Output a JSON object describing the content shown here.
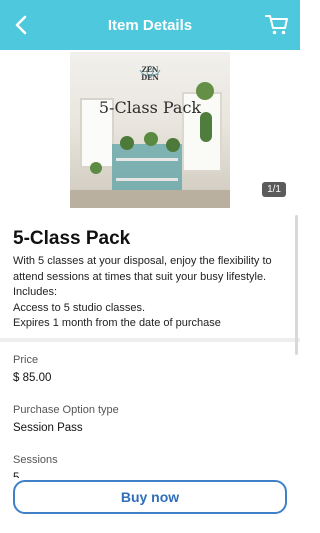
{
  "header": {
    "title": "Item Details",
    "back_icon": "chevron-left-icon",
    "cart_icon": "cart-icon"
  },
  "image": {
    "logo_line1": "ZEN",
    "logo_line2": "DEN",
    "caption": "5-Class Pack",
    "counter": "1/1"
  },
  "item": {
    "title": "5-Class Pack",
    "description_lines": [
      "With 5 classes at your disposal, enjoy the flexibility to",
      "attend sessions at times that suit your busy lifestyle.",
      "Includes:",
      "Access to 5 studio classes.",
      "Expires 1 month from the date of purchase"
    ]
  },
  "details": {
    "price_label": "Price",
    "price_value": "$ 85.00",
    "option_label": "Purchase Option type",
    "option_value": "Session Pass",
    "sessions_label": "Sessions",
    "sessions_value": "5"
  },
  "buy": {
    "label": "Buy now"
  },
  "colors": {
    "header_bg": "#4ec8dc",
    "button_border": "#3f80c9",
    "button_text": "#2f6fb8"
  }
}
